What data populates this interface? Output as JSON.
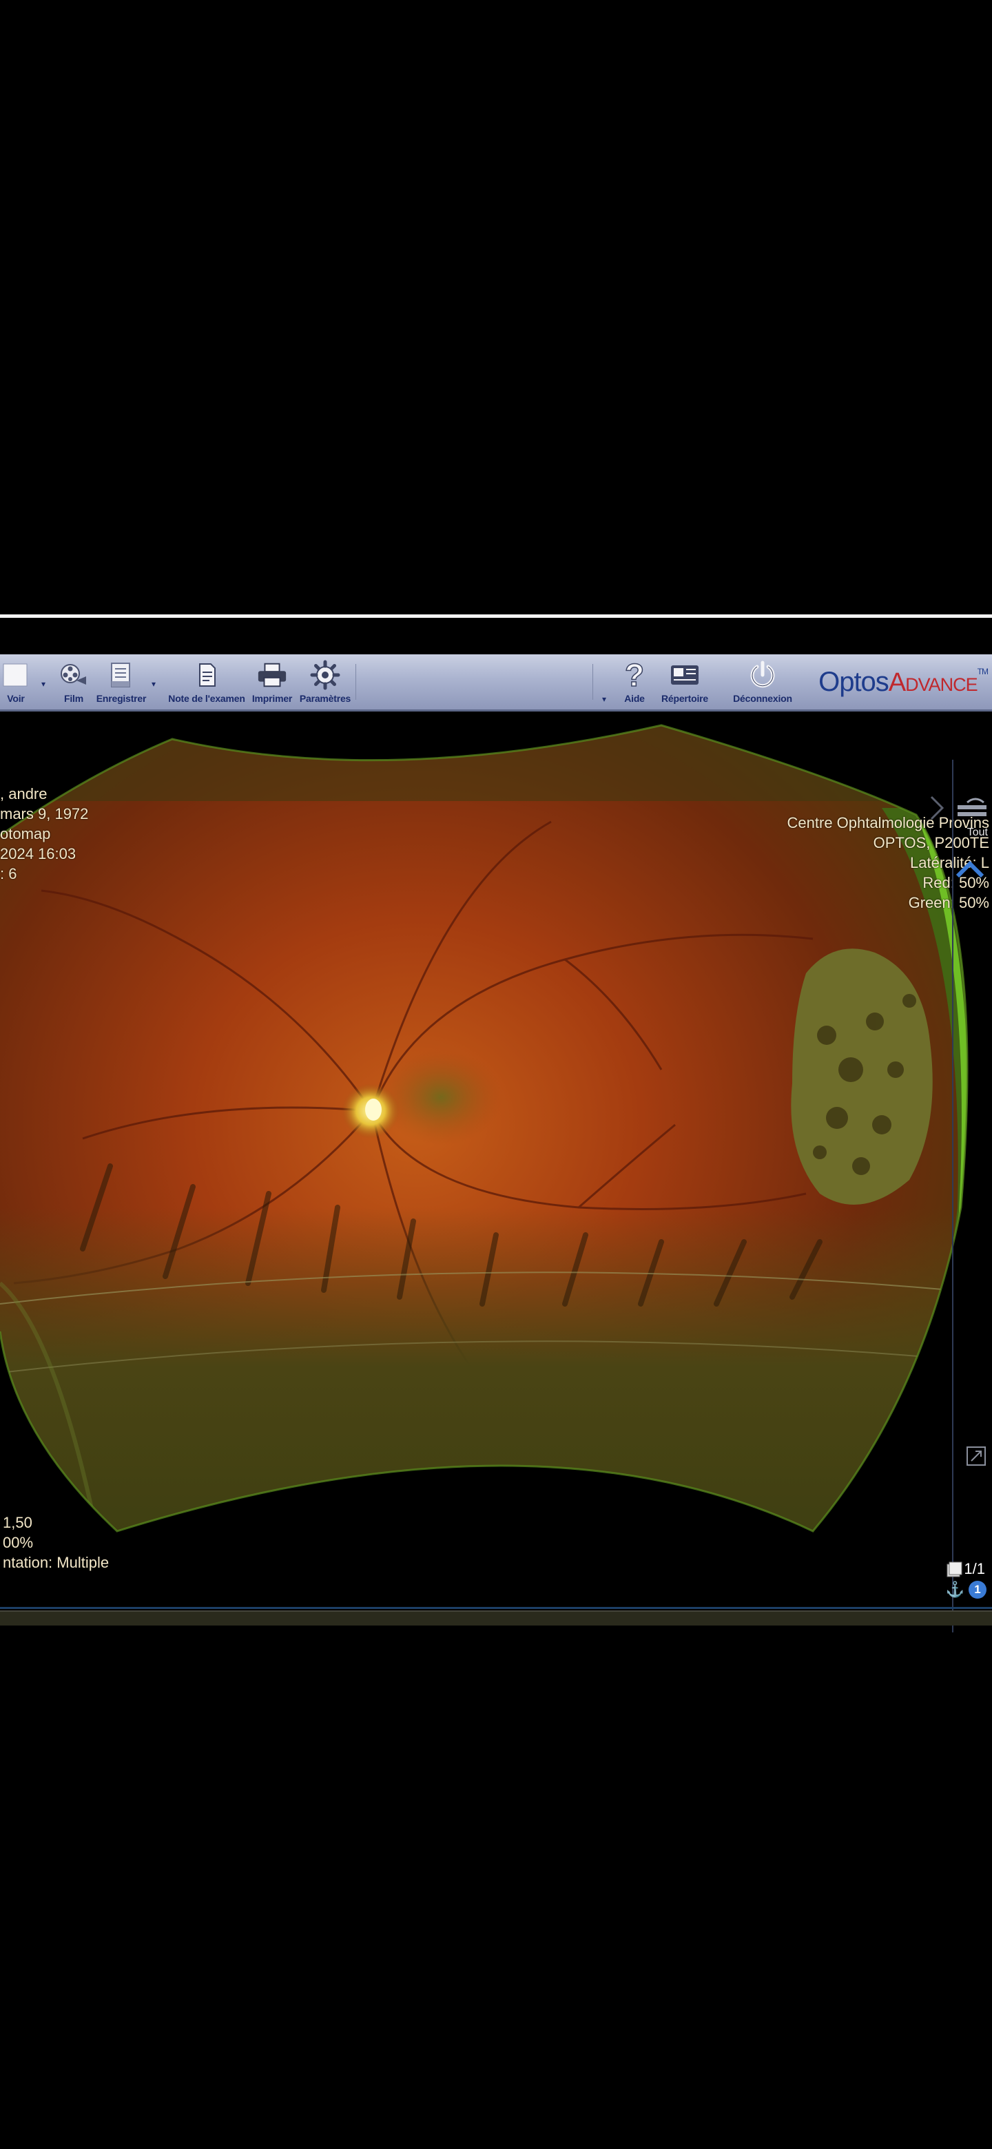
{
  "toolbar": {
    "buttons": [
      {
        "label": "Voir",
        "icon": "view-icon"
      },
      {
        "label": "Film",
        "icon": "film-reel-icon"
      },
      {
        "label": "Enregistrer",
        "icon": "save-document-icon"
      },
      {
        "label": "Note de l'examen",
        "icon": "note-icon"
      },
      {
        "label": "Imprimer",
        "icon": "printer-icon"
      },
      {
        "label": "Paramètres",
        "icon": "gear-icon"
      },
      {
        "label": "Aide",
        "icon": "help-question-icon"
      },
      {
        "label": "Répertoire",
        "icon": "directory-icon"
      },
      {
        "label": "Déconnexion",
        "icon": "power-icon"
      }
    ],
    "logo_optos": "Optos",
    "logo_advance": "Advance",
    "logo_tm": "TM"
  },
  "patient_info": {
    "name": ", andre",
    "birth_date": "mars 9, 1972",
    "modality": "otomap",
    "exam_date": "2024 16:03",
    "number": ": 6"
  },
  "site_info": {
    "clinic": "Centre Ophtalmologie Provins",
    "device": "OPTOS, P200TE",
    "laterality": "Latéralité: L",
    "red": "Red: 50%",
    "green": "Green: 50%"
  },
  "image_info": {
    "zoom": "1,50",
    "level": "00%",
    "orientation": "ntation: Multiple"
  },
  "side_panel": {
    "label": "Tout"
  },
  "footer": {
    "counter": "1/1",
    "badge": "1"
  },
  "colors": {
    "toolbar_label": "#1b2b6b",
    "logo_blue": "#1e3c8c",
    "logo_red": "#c0282d",
    "info_text": "#f3e7c8",
    "accent_blue": "#3a7bd5"
  }
}
